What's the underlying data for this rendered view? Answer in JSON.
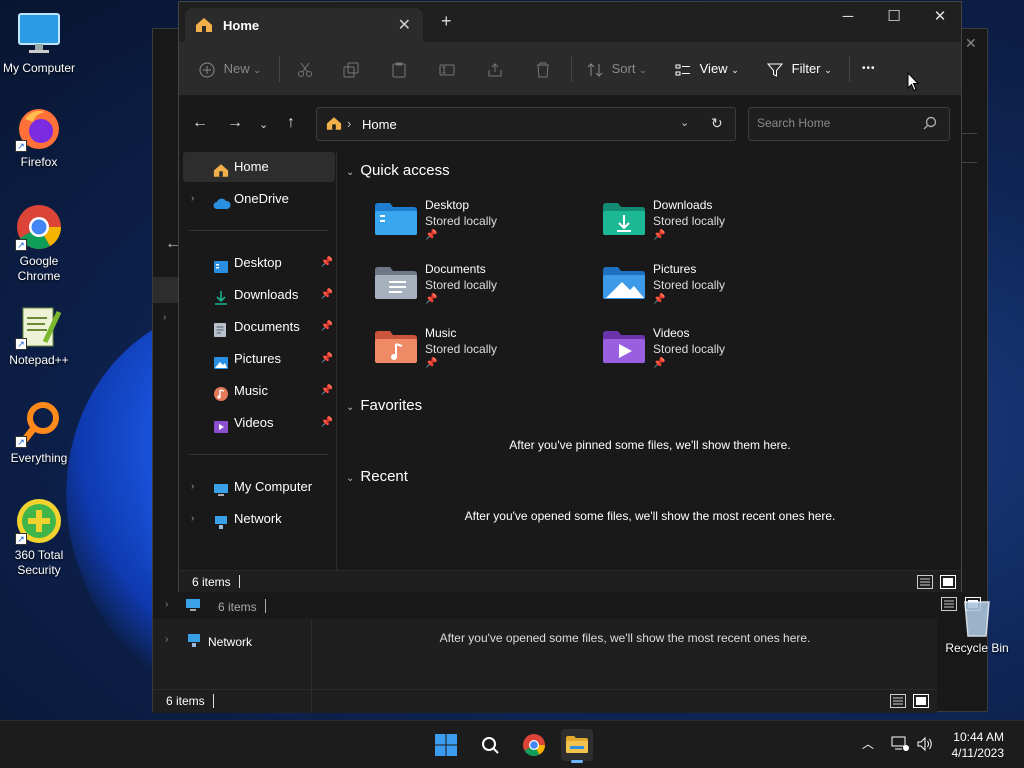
{
  "desktop": {
    "icons": [
      {
        "label": "My Computer"
      },
      {
        "label": "Firefox"
      },
      {
        "label": "Google Chrome"
      },
      {
        "label": "Notepad++"
      },
      {
        "label": "Everything"
      },
      {
        "label": "360 Total Security"
      },
      {
        "label": "Recycle Bin"
      }
    ]
  },
  "back_window": {
    "nav_items": [
      {
        "label": "Network"
      }
    ],
    "status_items": "6 items",
    "recent_msg": "After you've opened some files, we'll show the most recent ones here."
  },
  "window": {
    "tab_title": "Home",
    "toolbar": {
      "new": "New",
      "sort": "Sort",
      "view": "View",
      "filter": "Filter",
      "more": "•••"
    },
    "address": {
      "location": "Home"
    },
    "search": {
      "placeholder": "Search Home"
    },
    "nav": {
      "home": "Home",
      "onedrive": "OneDrive",
      "pinned": [
        {
          "label": "Desktop"
        },
        {
          "label": "Downloads"
        },
        {
          "label": "Documents"
        },
        {
          "label": "Pictures"
        },
        {
          "label": "Music"
        },
        {
          "label": "Videos"
        }
      ],
      "my_computer": "My Computer",
      "network": "Network"
    },
    "quick_access": {
      "title": "Quick access",
      "items": [
        {
          "name": "Desktop",
          "sub": "Stored locally",
          "color": "#2a8fe0"
        },
        {
          "name": "Downloads",
          "sub": "Stored locally",
          "color": "#19a88a"
        },
        {
          "name": "Documents",
          "sub": "Stored locally",
          "color": "#8a93a3"
        },
        {
          "name": "Pictures",
          "sub": "Stored locally",
          "color": "#3c8fd8"
        },
        {
          "name": "Music",
          "sub": "Stored locally",
          "color": "#e4795a"
        },
        {
          "name": "Videos",
          "sub": "Stored locally",
          "color": "#8a4fcf"
        }
      ]
    },
    "favorites": {
      "title": "Favorites",
      "message": "After you've pinned some files, we'll show them here."
    },
    "recent": {
      "title": "Recent",
      "message": "After you've opened some files, we'll show the most recent ones here."
    },
    "status": {
      "items": "6 items"
    }
  },
  "taskbar": {
    "time": "10:44 AM",
    "date": "4/11/2023"
  },
  "colors": {
    "windows_accent": "#3c8fd8",
    "folder_yellow": "#f2c14e"
  }
}
